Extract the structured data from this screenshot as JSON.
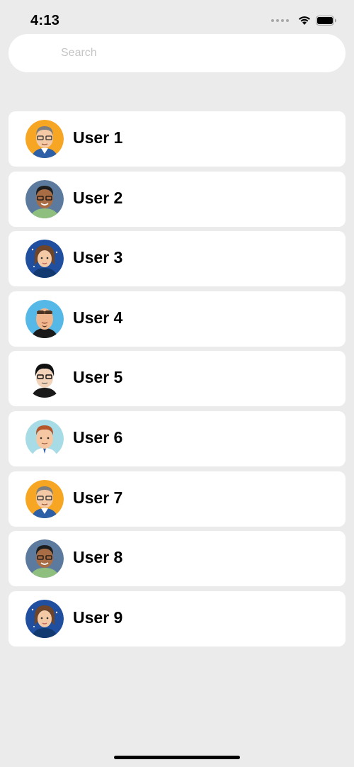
{
  "status_bar": {
    "time": "4:13",
    "icons": [
      "cellular-signal-icon",
      "wifi-icon",
      "battery-icon"
    ]
  },
  "search": {
    "placeholder": "Search"
  },
  "users": [
    {
      "name": "User 1",
      "avatar": "avatar-grey-hair-glasses-man",
      "bg": "#f6a623"
    },
    {
      "name": "User 2",
      "avatar": "avatar-dark-hair-glasses-man",
      "bg": "#5c7a9e"
    },
    {
      "name": "User 3",
      "avatar": "avatar-brown-hair-woman",
      "bg": "#1f4f9e"
    },
    {
      "name": "User 4",
      "avatar": "avatar-sunglasses-bald-man",
      "bg": "#55b8e6"
    },
    {
      "name": "User 5",
      "avatar": "avatar-black-hair-glasses-man",
      "bg": "#ffffff"
    },
    {
      "name": "User 6",
      "avatar": "avatar-red-hair-man",
      "bg": "#a7dbe6"
    },
    {
      "name": "User 7",
      "avatar": "avatar-grey-hair-glasses-man",
      "bg": "#f6a623"
    },
    {
      "name": "User 8",
      "avatar": "avatar-dark-hair-glasses-man",
      "bg": "#5c7a9e"
    },
    {
      "name": "User 9",
      "avatar": "avatar-brown-hair-woman",
      "bg": "#1f4f9e"
    }
  ]
}
